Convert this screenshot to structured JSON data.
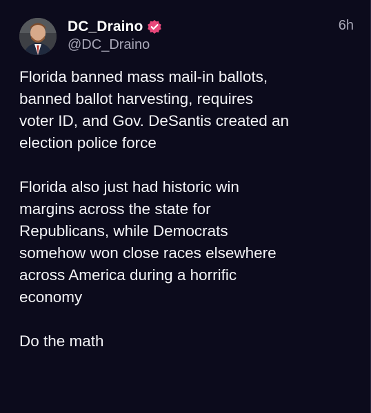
{
  "post": {
    "author": {
      "display_name": "DC_Draino",
      "handle": "@DC_Draino",
      "verified_icon": "verified-badge-icon",
      "badge_color": "#e8477a"
    },
    "time": "6h",
    "paragraphs": [
      "Florida banned mass mail-in ballots,\nbanned ballot harvesting, requires\nvoter ID, and Gov. DeSantis created an\nelection police force",
      "Florida also just had historic win\nmargins across the state for\nRepublicans, while Democrats\nsomehow won close races elsewhere\nacross America during a horrific\neconomy",
      "Do the math"
    ]
  }
}
